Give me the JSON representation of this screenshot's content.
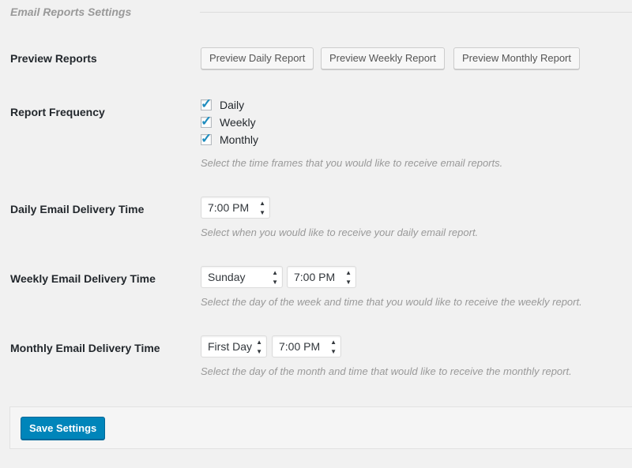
{
  "section": {
    "title": "Email Reports Settings"
  },
  "preview": {
    "label": "Preview Reports",
    "buttons": [
      "Preview Daily Report",
      "Preview Weekly Report",
      "Preview Monthly Report"
    ]
  },
  "frequency": {
    "label": "Report Frequency",
    "options": [
      {
        "label": "Daily",
        "checked": true
      },
      {
        "label": "Weekly",
        "checked": true
      },
      {
        "label": "Monthly",
        "checked": true
      }
    ],
    "description": "Select the time frames that you would like to receive email reports."
  },
  "daily": {
    "label": "Daily Email Delivery Time",
    "time": "7:00 PM",
    "description": "Select when you would like to receive your daily email report."
  },
  "weekly": {
    "label": "Weekly Email Delivery Time",
    "day": "Sunday",
    "time": "7:00 PM",
    "description": "Select the day of the week and time that you would like to receive the weekly report."
  },
  "monthly": {
    "label": "Monthly Email Delivery Time",
    "day": "First Day",
    "time": "7:00 PM",
    "description": "Select the day of the month and time that would like to receive the monthly report."
  },
  "footer": {
    "save_label": "Save Settings"
  },
  "icons": {
    "checkbox": "checkmark-icon",
    "select": "updown-arrows-icon"
  },
  "colors": {
    "primary": "#0085ba",
    "check": "#1e8cbe",
    "muted": "#999999"
  }
}
